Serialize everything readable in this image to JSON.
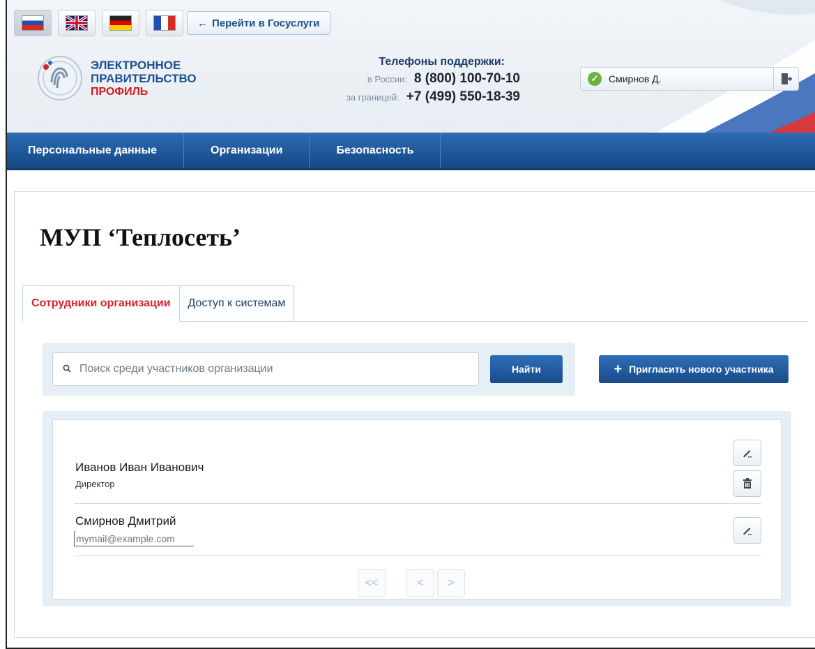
{
  "header": {
    "languages": [
      {
        "name": "ru",
        "active": true
      },
      {
        "name": "en",
        "active": false
      },
      {
        "name": "de",
        "active": false
      },
      {
        "name": "fr",
        "active": false
      }
    ],
    "gosuslugi_link": "Перейти в Госуслуги",
    "logo": {
      "line1": "ЭЛЕКТРОННОЕ",
      "line2": "ПРАВИТЕЛЬСТВО",
      "line3": "ПРОФИЛЬ"
    },
    "support": {
      "title": "Телефоны поддержки:",
      "russia_label": "в России:",
      "russia_phone": "8 (800) 100-70-10",
      "abroad_label": "за границей:",
      "abroad_phone": "+7 (499) 550-18-39"
    },
    "user": {
      "name": "Смирнов Д."
    }
  },
  "nav": {
    "items": [
      "Персональные данные",
      "Организации",
      "Безопасность"
    ]
  },
  "page": {
    "title": "МУП ‘Теплосеть’",
    "tabs": [
      {
        "label": "Сотрудники организации",
        "active": true
      },
      {
        "label": "Доступ к системам",
        "active": false
      }
    ],
    "search": {
      "placeholder": "Поиск среди участников организации",
      "button": "Найти"
    },
    "invite_button": "Пригласить нового участника",
    "members": [
      {
        "name": "Иванов Иван Иванович",
        "role": "Директор"
      },
      {
        "name": "Смирнов Дмитрий",
        "email_placeholder": "mymail@example.com"
      }
    ],
    "pager": {
      "first": "<<",
      "prev": "<",
      "next": ">"
    }
  },
  "colors": {
    "nav_blue": "#1d5698",
    "active_tab_red": "#d8212a",
    "button_blue": "#174b8a",
    "panel_bg": "#e6eff6"
  }
}
